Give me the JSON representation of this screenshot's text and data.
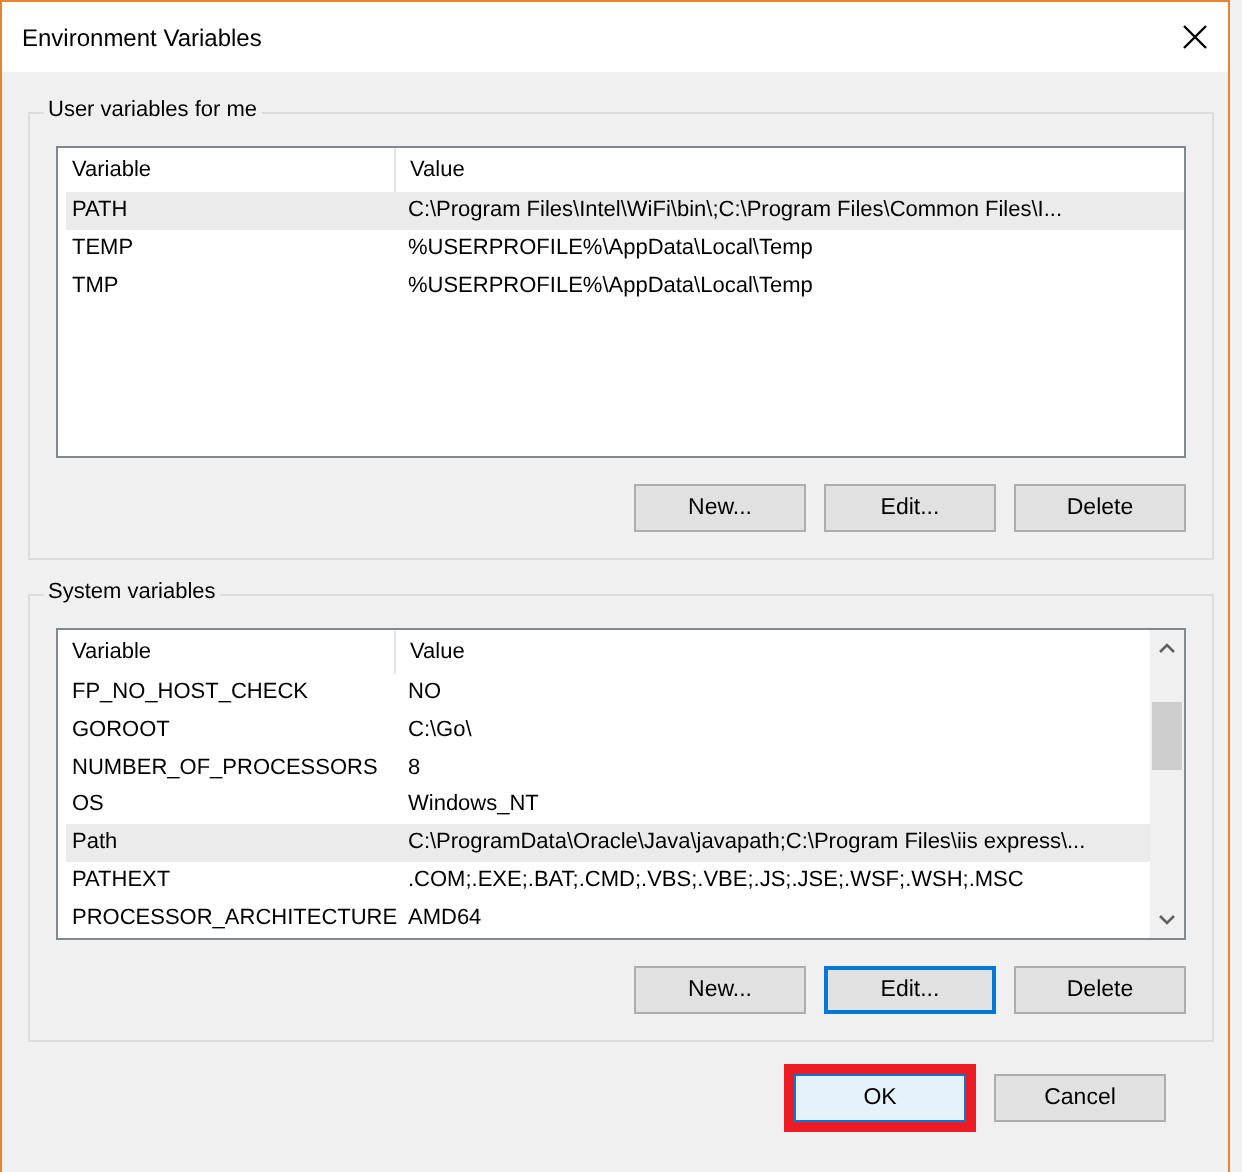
{
  "window": {
    "title": "Environment Variables"
  },
  "groups": [
    {
      "title": "User variables for me",
      "columns": [
        "Variable",
        "Value"
      ],
      "scrollbar": false,
      "rows": [
        {
          "cells": [
            "PATH",
            "C:\\Program Files\\Intel\\WiFi\\bin\\;C:\\Program Files\\Common Files\\I..."
          ],
          "selected": true
        },
        {
          "cells": [
            "TEMP",
            "%USERPROFILE%\\AppData\\Local\\Temp"
          ],
          "selected": false
        },
        {
          "cells": [
            "TMP",
            "%USERPROFILE%\\AppData\\Local\\Temp"
          ],
          "selected": false
        }
      ],
      "buttons": [
        {
          "label": "New...",
          "focused": false
        },
        {
          "label": "Edit...",
          "focused": false
        },
        {
          "label": "Delete",
          "focused": false
        }
      ]
    },
    {
      "title": "System variables",
      "columns": [
        "Variable",
        "Value"
      ],
      "scrollbar": true,
      "rows": [
        {
          "cells": [
            "FP_NO_HOST_CHECK",
            "NO"
          ],
          "selected": false
        },
        {
          "cells": [
            "GOROOT",
            "C:\\Go\\"
          ],
          "selected": false
        },
        {
          "cells": [
            "NUMBER_OF_PROCESSORS",
            "8"
          ],
          "selected": false
        },
        {
          "cells": [
            "OS",
            "Windows_NT"
          ],
          "selected": false
        },
        {
          "cells": [
            "Path",
            "C:\\ProgramData\\Oracle\\Java\\javapath;C:\\Program Files\\iis express\\..."
          ],
          "selected": true
        },
        {
          "cells": [
            "PATHEXT",
            ".COM;.EXE;.BAT;.CMD;.VBS;.VBE;.JS;.JSE;.WSF;.WSH;.MSC"
          ],
          "selected": false
        },
        {
          "cells": [
            "PROCESSOR_ARCHITECTURE",
            "AMD64"
          ],
          "selected": false
        }
      ],
      "buttons": [
        {
          "label": "New...",
          "focused": false
        },
        {
          "label": "Edit...",
          "focused": true
        },
        {
          "label": "Delete",
          "focused": false
        }
      ]
    }
  ],
  "footer_buttons": [
    {
      "label": "OK",
      "default": true,
      "highlighted": true
    },
    {
      "label": "Cancel",
      "default": false,
      "highlighted": false
    }
  ]
}
